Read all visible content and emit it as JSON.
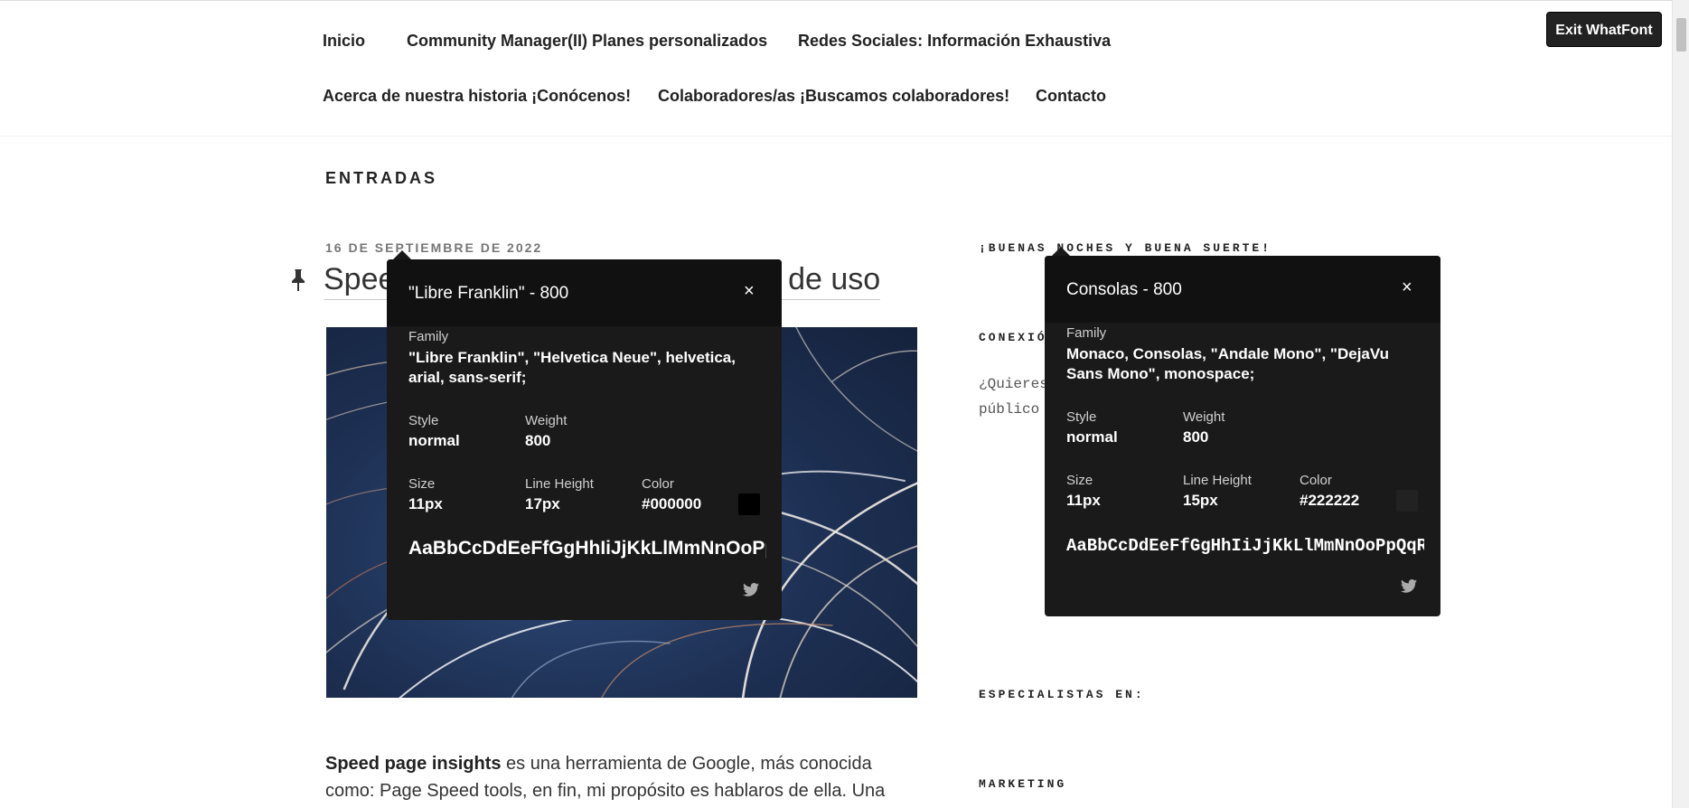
{
  "nav": {
    "items": [
      "Inicio",
      "Community Manager(II) Planes personalizados",
      "Redes Sociales: Información Exhaustiva",
      "Acerca de nuestra historia ¡Conócenos!",
      "Colaboradores/as ¡Buscamos colaboradores!",
      "Contacto"
    ]
  },
  "whatfont": {
    "exit_label": "Exit WhatFont"
  },
  "main": {
    "section_title": "ENTRADAS",
    "post": {
      "date": "16 DE SEPTIEMBRE DE 2022",
      "title": "Speed page insights/ Guía rápida de uso",
      "body_bold": "Speed page insights",
      "body_line1": " es una herramienta de Google, más conocida",
      "body_line2": "como: Page Speed tools, en fin, mi propósito es hablaros de ella. Una"
    }
  },
  "sidebar": {
    "greeting": "¡BUENAS NOCHES Y BUENA SUERTE!",
    "conexion": "CONEXIÓN",
    "question_line1": "¿Quieres conectar mejor con su",
    "question_line2": "público objetivo?",
    "specialists": "ESPECIALISTAS EN:",
    "marketing": "MARKETING"
  },
  "panel_left": {
    "title": "\"Libre Franklin\" - 800",
    "family_label": "Family",
    "family_line1": "\"Libre Franklin\", \"Helvetica Neue\", helvetica,",
    "family_line2": "arial, sans-serif;",
    "style_label": "Style",
    "style": "normal",
    "weight_label": "Weight",
    "weight": "800",
    "size_label": "Size",
    "size": "11px",
    "lineheight_label": "Line Height",
    "lineheight": "17px",
    "color_label": "Color",
    "color": "#000000",
    "sample": "AaBbCcDdEeFfGgHhIiJjKkLlMmNnOoPpQqRrSsTtUuVvWwXxYyZz",
    "close": "×"
  },
  "panel_right": {
    "title": "Consolas - 800",
    "family_label": "Family",
    "family_line1": "Monaco, Consolas, \"Andale Mono\", \"DejaVu",
    "family_line2": "Sans Mono\", monospace;",
    "style_label": "Style",
    "style": "normal",
    "weight_label": "Weight",
    "weight": "800",
    "size_label": "Size",
    "size": "11px",
    "lineheight_label": "Line Height",
    "lineheight": "15px",
    "color_label": "Color",
    "color": "#222222",
    "sample": "AaBbCcDdEeFfGgHhIiJjKkLlMmNnOoPpQqRrSsTtUuVvWwXxYyZz",
    "close": "×"
  },
  "colors": {
    "panel_bg": "#1a1a1a",
    "swatch_left": "#000000",
    "swatch_right": "#222222"
  }
}
